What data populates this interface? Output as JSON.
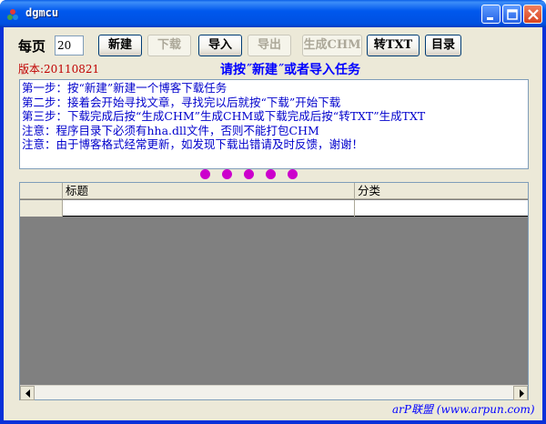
{
  "window": {
    "title": "dgmcu",
    "icons": {
      "app": "app-icon",
      "minimize": "minimize-icon",
      "maximize": "maximize-icon",
      "close": "close-icon"
    }
  },
  "toolbar": {
    "per_page_label": "每页",
    "per_page_value": "20",
    "buttons": {
      "new": "新建",
      "download": "下载",
      "import": "导入",
      "export": "导出",
      "chm": "生成CHM",
      "txt": "转TXT",
      "toc": "目录"
    }
  },
  "version": "版本:20110821",
  "prompt": "请按˝新建˝或者导入任务",
  "instructions": [
    "第一步：按“新建”新建一个博客下载任务",
    "第二步：接着会开始寻找文章，寻找完以后就按“下载”开始下载",
    "第三步：下载完成后按“生成CHM”生成CHM或下载完成后按“转TXT”生成TXT",
    "注意：程序目录下必须有hha.dll文件，否则不能打包CHM",
    "注意：由于博客格式经常更新，如发现下载出错请及时反馈，谢谢！"
  ],
  "table": {
    "columns": [
      "",
      "标题",
      "分类"
    ]
  },
  "footer": "arP联盟 (www.arpun.com)",
  "colors": {
    "dots": "#cc00cc",
    "prompt": "#0000ff",
    "version": "#c00000",
    "notes_text": "#0000cc"
  }
}
